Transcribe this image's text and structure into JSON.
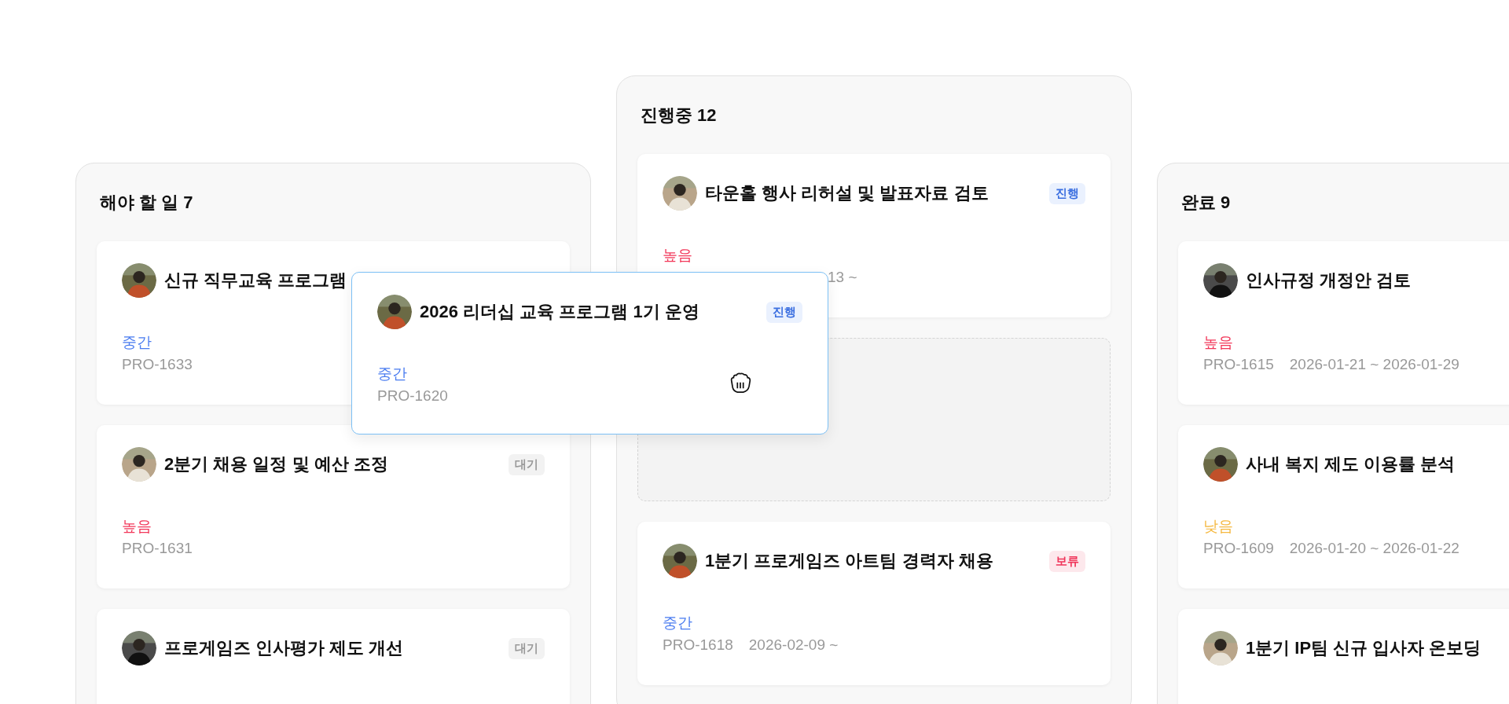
{
  "columns": [
    {
      "title": "해야 할 일 7",
      "drop_target": false,
      "cards": [
        {
          "kind": "task",
          "title": "신규 직무교육 프로그램",
          "priority": {
            "label": "중간",
            "kind": "medium"
          },
          "id": "PRO-1633"
        },
        {
          "kind": "task",
          "title": "2분기 채용 일정 및 예산 조정",
          "status": {
            "label": "대기",
            "kind": "waiting"
          },
          "priority": {
            "label": "높음",
            "kind": "high"
          },
          "id": "PRO-1631"
        },
        {
          "kind": "task",
          "title": "프로게임즈 인사평가 제도 개선",
          "status": {
            "label": "대기",
            "kind": "waiting"
          }
        }
      ]
    },
    {
      "title": "진행중 12",
      "drop_target": true,
      "cards": [
        {
          "kind": "task",
          "title": "타운홀 행사 리허설 및 발표자료 검토",
          "status": {
            "label": "진행",
            "kind": "progress"
          },
          "priority": {
            "label": "높음",
            "kind": "high"
          },
          "date": "13 ~"
        },
        {
          "kind": "placeholder"
        },
        {
          "kind": "task",
          "title": "1분기 프로게임즈 아트팀 경력자 채용",
          "status": {
            "label": "보류",
            "kind": "hold"
          },
          "priority": {
            "label": "중간",
            "kind": "medium"
          },
          "id": "PRO-1618",
          "date": "2026-02-09 ~"
        }
      ]
    },
    {
      "title": "완료 9",
      "drop_target": false,
      "cards": [
        {
          "kind": "task",
          "title": "인사규정 개정안 검토",
          "priority": {
            "label": "높음",
            "kind": "high"
          },
          "id": "PRO-1615",
          "date": "2026-01-21 ~ 2026-01-29"
        },
        {
          "kind": "task",
          "title": "사내 복지 제도 이용률 분석",
          "priority": {
            "label": "낮음",
            "kind": "low"
          },
          "id": "PRO-1609",
          "date": "2026-01-20 ~ 2026-01-22"
        },
        {
          "kind": "task",
          "title": "1분기 IP팀 신규 입사자 온보딩"
        }
      ]
    }
  ],
  "dragging_card": {
    "kind": "task",
    "title": "2026 리더십 교육 프로그램 1기 운영",
    "status": {
      "label": "진행",
      "kind": "progress"
    },
    "priority": {
      "label": "중간",
      "kind": "medium"
    },
    "id": "PRO-1620"
  }
}
